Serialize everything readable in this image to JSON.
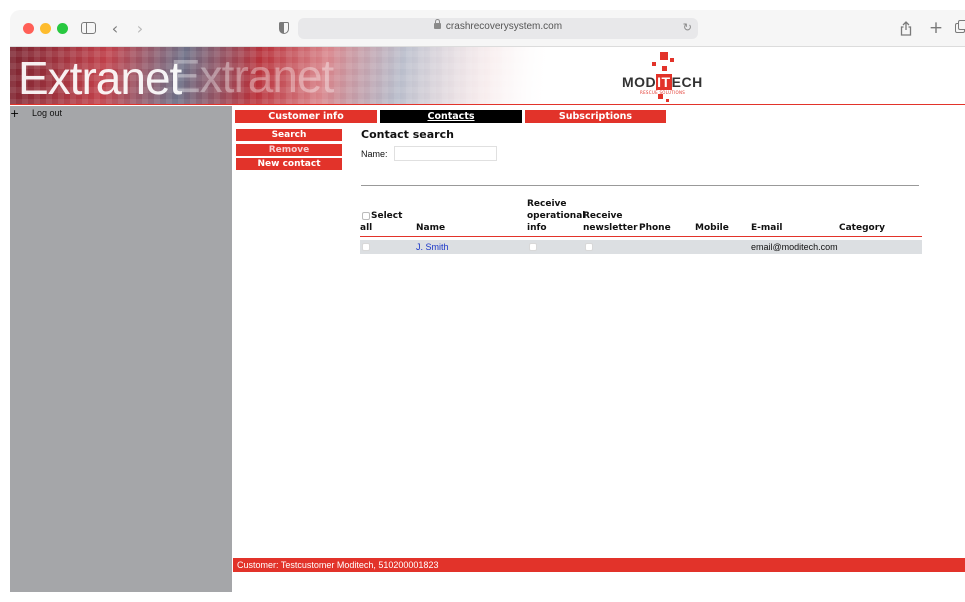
{
  "browser": {
    "url": "crashrecoverysystem.com",
    "icons": [
      "sidebar-icon",
      "chevron-left-icon",
      "chevron-right-icon",
      "shield-icon",
      "lock-icon",
      "reload-icon",
      "share-icon",
      "plus-icon",
      "tabs-icon"
    ]
  },
  "banner": {
    "title": "Extranet",
    "logo_text_prefix": "MOD",
    "logo_text_box": "IT",
    "logo_text_suffix": "ECH",
    "logo_tagline": "RESCUE SOLUTIONS"
  },
  "sidebar": {
    "toggle_symbol": "+",
    "logout_label": "Log out"
  },
  "tabs": [
    {
      "label": "Customer info",
      "active": false
    },
    {
      "label": "Contacts",
      "active": true
    },
    {
      "label": "Subscriptions",
      "active": false
    }
  ],
  "actions": {
    "search_label": "Search",
    "remove_label": "Remove",
    "new_contact_label": "New contact"
  },
  "search": {
    "title": "Contact search",
    "name_label": "Name:",
    "name_value": ""
  },
  "table": {
    "columns": {
      "select_all_line1": "Select",
      "select_all_line2": "all",
      "name": "Name",
      "operational_line1": "Receive",
      "operational_line2": "operational",
      "operational_line3": "info",
      "newsletter_line1": "Receive",
      "newsletter_line2": "newsletter",
      "phone": "Phone",
      "mobile": "Mobile",
      "email": "E-mail",
      "category": "Category"
    },
    "rows": [
      {
        "name": "J. Smith",
        "phone": "",
        "mobile": "",
        "email": "email@moditech.com",
        "category": "",
        "selected": false,
        "operational": false,
        "newsletter": false
      }
    ]
  },
  "footer": {
    "text": "Customer: Testcustomer Moditech, 510200001823"
  },
  "colors": {
    "accent": "#e2332a",
    "panel": "#a5a6a9",
    "active_tab": "#000000",
    "link": "#1a36c8"
  }
}
